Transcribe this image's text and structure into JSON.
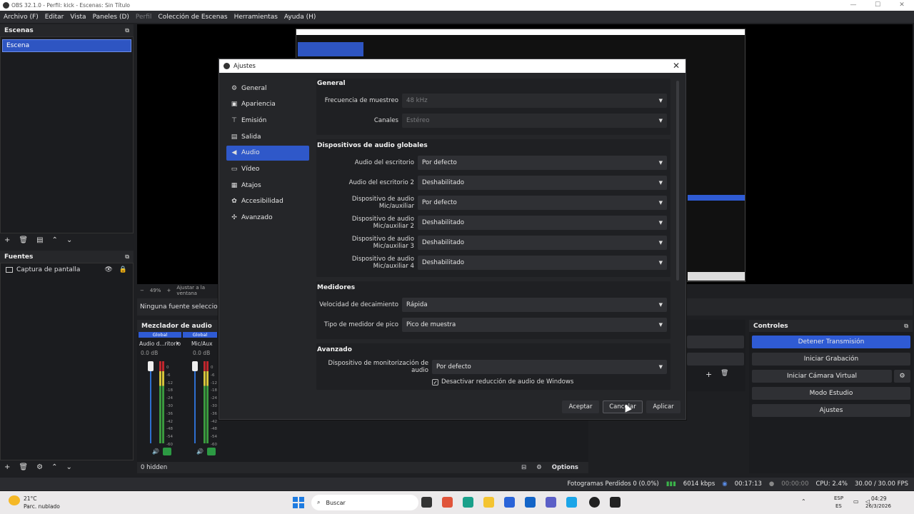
{
  "window": {
    "title": "OBS 32.1.0 - Perfil: kick - Escenas: Sin Título"
  },
  "menu": [
    "Archivo (F)",
    "Editar",
    "Vista",
    "Paneles (D)",
    "Perfil",
    "Colección de Escenas",
    "Herramientas",
    "Ayuda (H)"
  ],
  "scenes": {
    "title": "Escenas",
    "items": [
      "Escena"
    ]
  },
  "sources": {
    "title": "Fuentes",
    "items": [
      "Captura de pantalla"
    ],
    "none_selected": "Ninguna fuente seleccionada"
  },
  "preview_bar": {
    "zoom": "49%",
    "fit": "Ajustar a la ventana"
  },
  "mixer": {
    "title": "Mezclador de audio",
    "channels": [
      {
        "label": "Global",
        "name": "Audio d...ritorio",
        "db": "0.0 dB"
      },
      {
        "label": "Global",
        "name": "Mic/Aux",
        "db": "0.0 dB"
      }
    ],
    "ticks": [
      "0",
      "-6",
      "-12",
      "-18",
      "-24",
      "-30",
      "-36",
      "-42",
      "-48",
      "-54",
      "-60"
    ],
    "hidden": "0 hidden",
    "options": "Options"
  },
  "controls": {
    "title": "Controles",
    "buttons": [
      "Detener Transmisión",
      "Iniciar Grabación",
      "Iniciar Cámara Virtual",
      "Modo Estudio",
      "Ajustes"
    ]
  },
  "dialog": {
    "title": "Ajustes",
    "close": "✕",
    "nav": [
      {
        "label": "General",
        "icon": "⚙"
      },
      {
        "label": "Apariencia",
        "icon": "▣"
      },
      {
        "label": "Emisión",
        "icon": "⊤"
      },
      {
        "label": "Salida",
        "icon": "▤"
      },
      {
        "label": "Audio",
        "icon": "◀"
      },
      {
        "label": "Vídeo",
        "icon": "▭"
      },
      {
        "label": "Atajos",
        "icon": "▦"
      },
      {
        "label": "Accesibilidad",
        "icon": "✿"
      },
      {
        "label": "Avanzado",
        "icon": "✣"
      }
    ],
    "sections": {
      "general": {
        "title": "General",
        "rows": [
          {
            "label": "Frecuencia de muestreo",
            "value": "48 kHz"
          },
          {
            "label": "Canales",
            "value": "Estéreo"
          }
        ]
      },
      "devices": {
        "title": "Dispositivos de audio globales",
        "rows": [
          {
            "label": "Audio del escritorio",
            "value": "Por defecto"
          },
          {
            "label": "Audio del escritorio 2",
            "value": "Deshabilitado"
          },
          {
            "label": "Dispositivo de audio Mic/auxiliar",
            "value": "Por defecto"
          },
          {
            "label": "Dispositivo de audio Mic/auxiliar 2",
            "value": "Deshabilitado"
          },
          {
            "label": "Dispositivo de audio Mic/auxiliar 3",
            "value": "Deshabilitado"
          },
          {
            "label": "Dispositivo de audio Mic/auxiliar 4",
            "value": "Deshabilitado"
          }
        ]
      },
      "meters": {
        "title": "Medidores",
        "rows": [
          {
            "label": "Velocidad de decaimiento",
            "value": "Rápida"
          },
          {
            "label": "Tipo de medidor de pico",
            "value": "Pico de muestra"
          }
        ]
      },
      "advanced": {
        "title": "Avanzado",
        "rows": [
          {
            "label": "Dispositivo de monitorización de audio",
            "value": "Por defecto"
          }
        ],
        "checkbox": "Desactivar reducción de audio de Windows"
      }
    },
    "buttons": {
      "ok": "Aceptar",
      "cancel": "Cancelar",
      "apply": "Aplicar"
    }
  },
  "status": {
    "dropped": "Fotogramas Perdidos 0 (0.0%)",
    "kbps": "6014 kbps",
    "live": "00:17:13",
    "rec": "00:00:00",
    "cpu": "CPU: 2.4%",
    "fps": "30.00 / 30.00 FPS"
  },
  "taskbar": {
    "weather_temp": "21°C",
    "weather_desc": "Parc. nublado",
    "search": "Buscar",
    "lang": "ESP",
    "lang2": "ES",
    "time": "04:29",
    "date": "26/3/2026"
  }
}
